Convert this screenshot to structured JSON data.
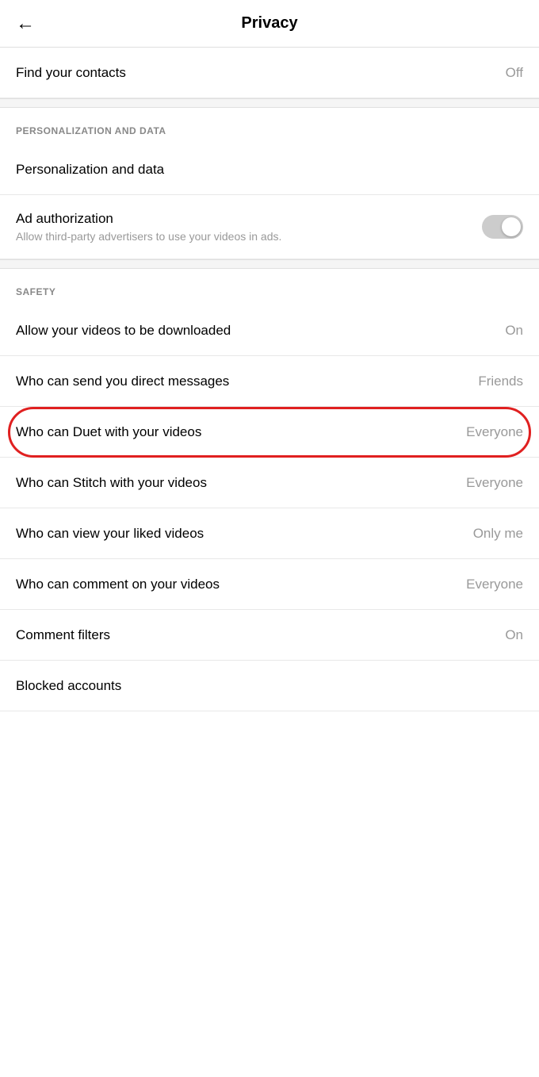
{
  "header": {
    "title": "Privacy",
    "back_label": "←"
  },
  "rows": {
    "find_contacts_label": "Find your contacts",
    "find_contacts_value": "Off",
    "personalization_section": "PERSONALIZATION AND DATA",
    "personalization_data_label": "Personalization and data",
    "ad_authorization_label": "Ad authorization",
    "ad_authorization_description": "Allow third-party advertisers to use your videos in ads.",
    "safety_section": "SAFETY",
    "allow_downloads_label": "Allow your videos to be downloaded",
    "allow_downloads_value": "On",
    "direct_messages_label": "Who can send you direct messages",
    "direct_messages_value": "Friends",
    "duet_label": "Who can Duet with your videos",
    "duet_value": "Everyone",
    "stitch_label": "Who can Stitch with your videos",
    "stitch_value": "Everyone",
    "liked_videos_label": "Who can view your liked videos",
    "liked_videos_value": "Only me",
    "comment_label": "Who can comment on your videos",
    "comment_value": "Everyone",
    "comment_filters_label": "Comment filters",
    "comment_filters_value": "On",
    "blocked_accounts_label": "Blocked accounts"
  }
}
